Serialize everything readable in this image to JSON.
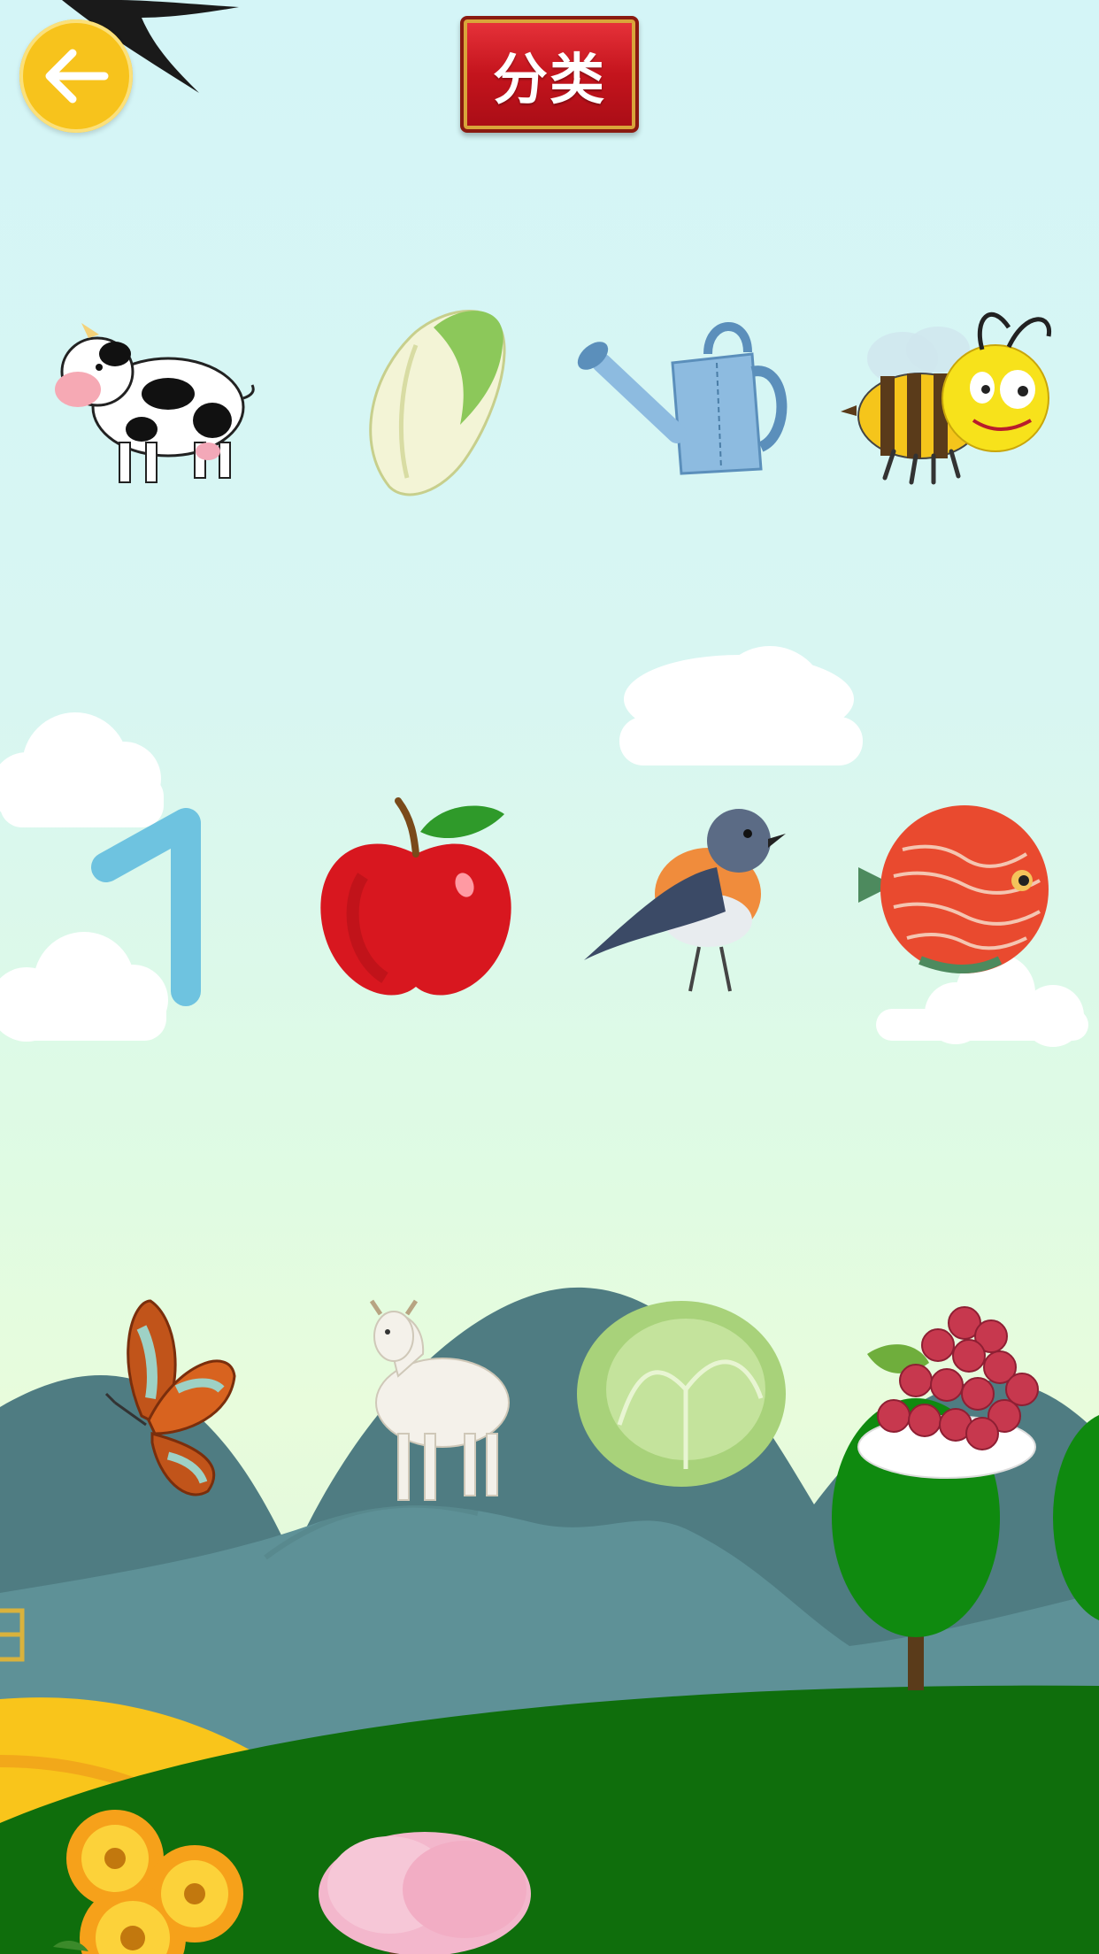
{
  "header": {
    "title": "分类",
    "back_icon": "arrow-left-icon"
  },
  "background": {
    "sky_top": "#d4f5f7",
    "grass": "#0f6e0c",
    "mountain": "#5b8a8f",
    "sun": "#f9c51b"
  },
  "grid": {
    "items": [
      {
        "name": "cow"
      },
      {
        "name": "chinese-cabbage"
      },
      {
        "name": "watering-can"
      },
      {
        "name": "bee"
      },
      {
        "name": "number-one",
        "text": "1"
      },
      {
        "name": "apple"
      },
      {
        "name": "bird"
      },
      {
        "name": "fish"
      },
      {
        "name": "butterfly"
      },
      {
        "name": "goat"
      },
      {
        "name": "cabbage"
      },
      {
        "name": "grapes"
      },
      {
        "name": "flowers"
      },
      {
        "name": "cherry-blossom-tree"
      }
    ]
  }
}
